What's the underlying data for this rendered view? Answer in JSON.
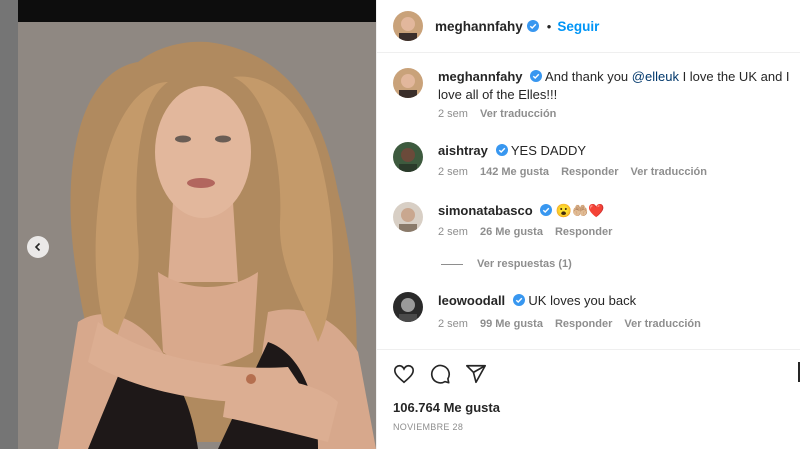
{
  "post": {
    "username": "meghannfahy",
    "separator": "•",
    "follow_label": "Seguir"
  },
  "comments": [
    {
      "username": "meghannfahy",
      "text_before": "And thank you ",
      "mention": "@elleuk",
      "text_after": " I love the UK and I love all of the Elles!!!",
      "time": "2 sem",
      "translate": "Ver traducción"
    },
    {
      "username": "aishtray",
      "text": "YES DADDY",
      "time": "2 sem",
      "likes": "142 Me gusta",
      "reply": "Responder",
      "translate": "Ver traducción"
    },
    {
      "username": "simonatabasco",
      "text": "😮🤲🏼❤️",
      "time": "2 sem",
      "likes": "26 Me gusta",
      "reply": "Responder",
      "view_replies": "Ver respuestas (1)"
    },
    {
      "username": "leowoodall",
      "text": "UK loves you back",
      "time": "2 sem",
      "likes": "99 Me gusta",
      "reply": "Responder",
      "translate": "Ver traducción"
    }
  ],
  "actions": {
    "icons": [
      "heart-icon",
      "comment-icon",
      "share-icon"
    ],
    "likes_count": "106.764 Me gusta",
    "date": "NOVIEMBRE 28"
  },
  "colors": {
    "link_blue": "#0095f6",
    "mention": "#00376b",
    "muted": "#8e8e8e",
    "verified": "#3897f0"
  }
}
